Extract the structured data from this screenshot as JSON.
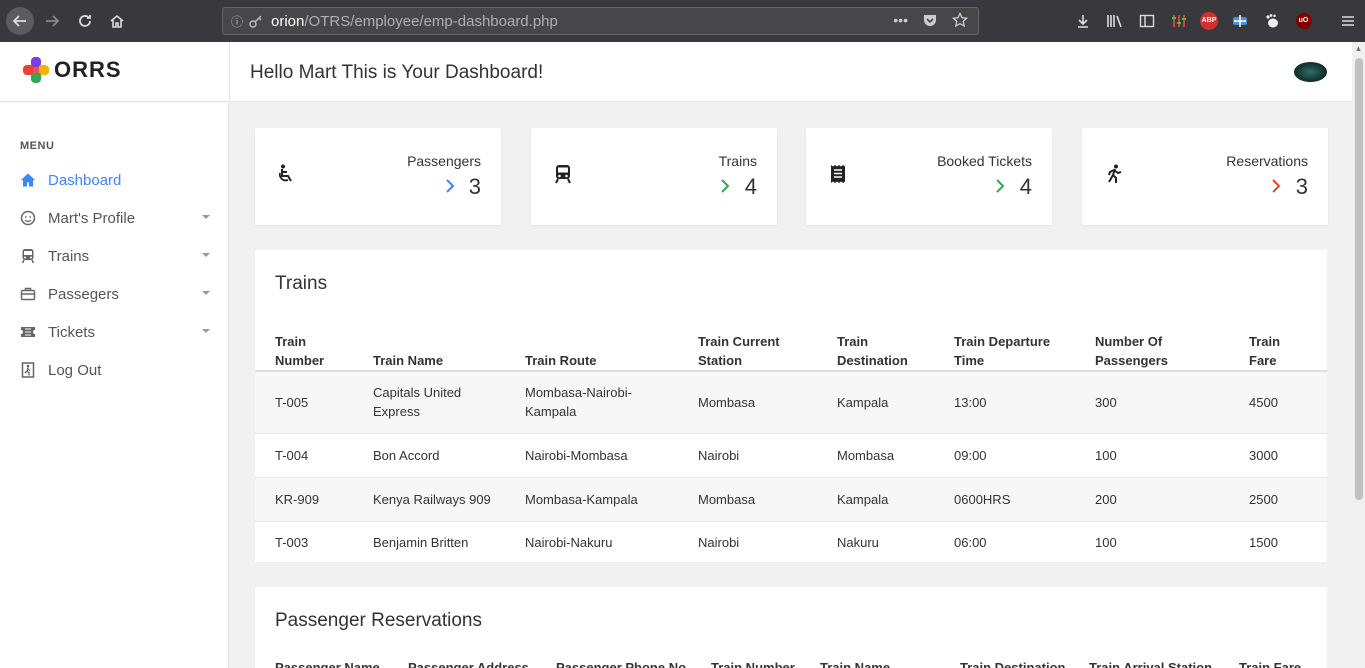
{
  "browser": {
    "url_host": "orion",
    "url_path": "/OTRS/employee/emp-dashboard.php",
    "more_glyph": "•••"
  },
  "app": {
    "logo_text": "ORRS",
    "greeting": "Hello Mart This is Your Dashboard!"
  },
  "sidebar": {
    "menu_title": "MENU",
    "items": [
      {
        "label": "Dashboard",
        "icon": "home-icon",
        "active": true
      },
      {
        "label": "Mart's Profile",
        "icon": "user-smile-icon",
        "caret": true
      },
      {
        "label": "Trains",
        "icon": "train-icon",
        "caret": true
      },
      {
        "label": "Passegers",
        "icon": "briefcase-icon",
        "caret": true
      },
      {
        "label": "Tickets",
        "icon": "ticket-icon",
        "caret": true
      },
      {
        "label": "Log Out",
        "icon": "exit-door-icon"
      }
    ]
  },
  "cards": [
    {
      "label": "Passengers",
      "value": "3",
      "icon": "wheelchair-icon",
      "arrow_color": "#3b86ff"
    },
    {
      "label": "Trains",
      "value": "4",
      "icon": "train-icon",
      "arrow_color": "#34a853"
    },
    {
      "label": "Booked Tickets",
      "value": "4",
      "icon": "receipt-icon",
      "arrow_color": "#34a853"
    },
    {
      "label": "Reservations",
      "value": "3",
      "icon": "walking-person-icon",
      "arrow_color": "#ea4335"
    }
  ],
  "trains_table": {
    "title": "Trains",
    "headers": [
      [
        "Train",
        "Number"
      ],
      [
        "Train Name"
      ],
      [
        "Train Route"
      ],
      [
        "Train Current",
        "Station"
      ],
      [
        "Train",
        "Destination"
      ],
      [
        "Train Departure",
        "Time"
      ],
      [
        "Number Of",
        "Passengers"
      ],
      [
        "Train",
        "Fare"
      ]
    ],
    "rows": [
      [
        "T-005",
        "Capitals United Express",
        "Mombasa-Nairobi-Kampala",
        "Mombasa",
        "Kampala",
        "13:00",
        "300",
        "4500"
      ],
      [
        "T-004",
        "Bon Accord",
        "Nairobi-Mombasa",
        "Nairobi",
        "Mombasa",
        "09:00",
        "100",
        "3000"
      ],
      [
        "KR-909",
        "Kenya Railways 909",
        "Mombasa-Kampala",
        "Mombasa",
        "Kampala",
        "0600HRS",
        "200",
        "2500"
      ],
      [
        "T-003",
        "Benjamin Britten",
        "Nairobi-Nakuru",
        "Nairobi",
        "Nakuru",
        "06:00",
        "100",
        "1500"
      ]
    ]
  },
  "reservations_table": {
    "title": "Passenger Reservations",
    "headers": [
      "Passenger Name",
      "Passenger Address",
      "Passenger Phone No",
      "Train Number",
      "Train Name",
      "Train Destination",
      "Train Arrival Station",
      "Train Fare"
    ]
  }
}
